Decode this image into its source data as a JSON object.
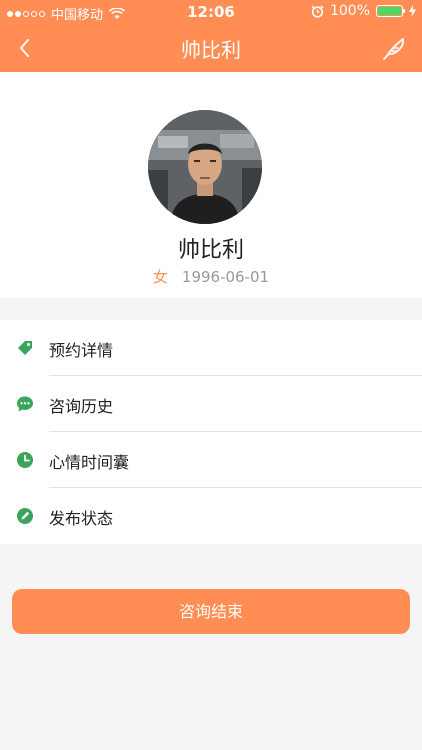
{
  "status_bar": {
    "carrier": "中国移动",
    "time": "12:06",
    "battery": "100%"
  },
  "nav": {
    "title": "帅比利"
  },
  "profile": {
    "name": "帅比利",
    "gender": "女",
    "birthday": "1996-06-01"
  },
  "menu": {
    "items": [
      {
        "label": "预约详情",
        "icon": "tag-icon"
      },
      {
        "label": "咨询历史",
        "icon": "chat-icon"
      },
      {
        "label": "心情时间囊",
        "icon": "clock-icon"
      },
      {
        "label": "发布状态",
        "icon": "edit-icon"
      }
    ]
  },
  "end_button": {
    "label": "咨询结束"
  },
  "colors": {
    "accent": "#ff8d54",
    "icon_green": "#3aa55a"
  }
}
